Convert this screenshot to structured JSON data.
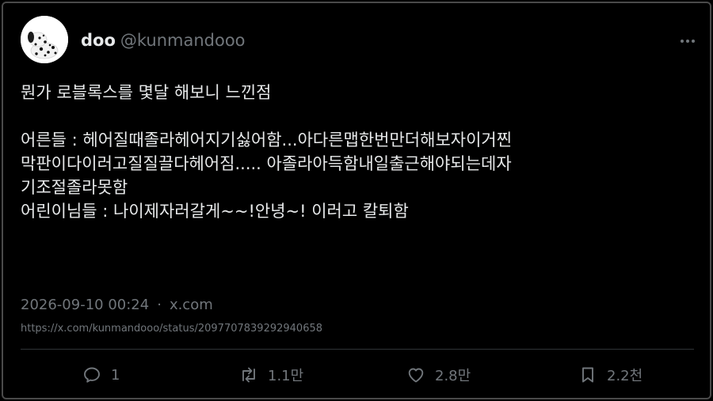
{
  "author": {
    "display_name": "doo",
    "handle": "@kunmandooo",
    "avatar_icon": "dalmatian-plush-avatar-icon"
  },
  "more_icon": "more-horizontal-icon",
  "tweet": {
    "lines": [
      "뭔가 로블록스를 몇달 해보니 느낀점",
      "",
      "어른들 : 헤어질때졸라헤어지기싫어함...아다른맵한번만더해보자이거찐",
      "막판이다이러고질질끌다헤어짐..... 아졸라아득함내일출근해야되는데자",
      "기조절졸라못함",
      "어린이님들 : 나이제자러갈게~~!안녕~! 이러고 칼퇴함"
    ]
  },
  "meta": {
    "timestamp": "2026-09-10 00:24",
    "separator": "·",
    "source": "x.com"
  },
  "url": "https://x.com/kunmandooo/status/2097707839292940658",
  "actions": {
    "reply": {
      "icon": "reply-icon",
      "count": "1"
    },
    "retweet": {
      "icon": "retweet-icon",
      "count": "1.1만"
    },
    "like": {
      "icon": "heart-icon",
      "count": "2.8만"
    },
    "bookmark": {
      "icon": "bookmark-icon",
      "count": "2.2천"
    }
  },
  "colors": {
    "background": "#000000",
    "text_primary": "#e7e9ea",
    "text_secondary": "#71767b",
    "divider": "#2f3336",
    "frame": "#4a4a4a"
  }
}
